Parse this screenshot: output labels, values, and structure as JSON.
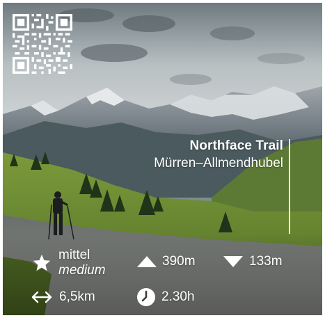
{
  "trail": {
    "name": "Northface Trail",
    "route": "Mürren–Allmendhubel"
  },
  "stats": {
    "difficulty_de": "mittel",
    "difficulty_en": "medium",
    "ascent": "390m",
    "descent": "133m",
    "distance": "6,5km",
    "duration": "2.30h"
  },
  "icons": {
    "difficulty": "star-icon",
    "ascent": "triangle-up-icon",
    "descent": "triangle-down-icon",
    "distance": "double-arrow-icon",
    "duration": "clock-icon",
    "qr": "qr-code"
  },
  "colors": {
    "text": "#ffffff"
  }
}
